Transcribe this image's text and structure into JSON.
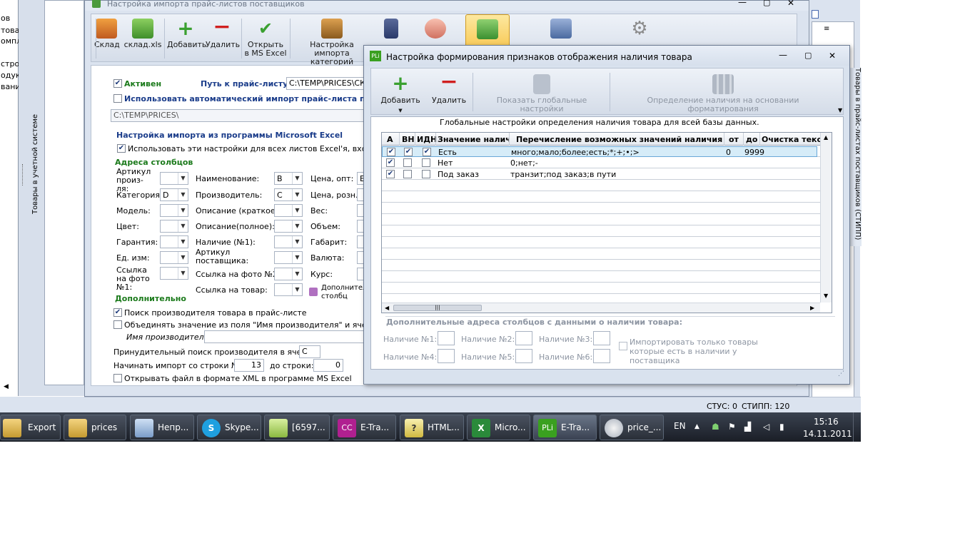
{
  "left_clip": {
    "lines": [
      "ов",
      "това",
      "омпл",
      "",
      "стро",
      "одук",
      "вани"
    ]
  },
  "main_window": {
    "title": "Настройка импорта прайс-листов поставщиков",
    "vertical_tab_left": "Товары в учетной системе",
    "toolbar": [
      {
        "label": "Склад",
        "icon": "truck-icon"
      },
      {
        "label": "склад.xls",
        "icon": "xls-icon"
      },
      {
        "label": "Добавить",
        "icon": "plus-icon"
      },
      {
        "label": "Удалить",
        "icon": "minus-icon"
      },
      {
        "label": "Открыть в MS Excel",
        "icon": "checkmark-icon"
      },
      {
        "label": "Настройка импорта категорий",
        "icon": "import-icon"
      }
    ],
    "active_label": "Активен",
    "path_label": "Путь к прайс-листу:",
    "path_value": "C:\\TEMP\\PRICES\\СКЛ",
    "auto_import_label": "Использовать автоматический импорт прайс-листа поста",
    "auto_path_value": "C:\\TEMP\\PRICES\\",
    "excel_group_title": "Настройка импорта из программы Microsoft Excel",
    "use_all_sheets_label": "Использовать эти настройки для всех листов Excel'я, входящих",
    "columns_group_title": "Адреса столбцов",
    "col1": [
      {
        "label": "Артикул произ-ля:",
        "value": ""
      },
      {
        "label": "Категория:",
        "value": "D"
      },
      {
        "label": "Модель:",
        "value": ""
      },
      {
        "label": "Цвет:",
        "value": ""
      },
      {
        "label": "Гарантия:",
        "value": ""
      },
      {
        "label": "Ед. изм:",
        "value": ""
      },
      {
        "label": "Ссылка на фото №1:",
        "value": ""
      }
    ],
    "col2": [
      {
        "label": "Наименование:",
        "value": "B"
      },
      {
        "label": "Производитель:",
        "value": "C"
      },
      {
        "label": "Описание (краткое):",
        "value": ""
      },
      {
        "label": "Описание(полное):",
        "value": ""
      },
      {
        "label": "Наличие (№1):",
        "value": ""
      },
      {
        "label": "Артикул поставщика:",
        "value": ""
      },
      {
        "label": "Ссылка на фото №2:",
        "value": ""
      },
      {
        "label": "Ссылка на товар:",
        "value": ""
      }
    ],
    "col3": [
      {
        "label": "Цена, опт:",
        "value": "E"
      },
      {
        "label": "Цена, розн.:",
        "value": ""
      },
      {
        "label": "Вес:",
        "value": ""
      },
      {
        "label": "Объем:",
        "value": ""
      },
      {
        "label": "Габарит:",
        "value": ""
      },
      {
        "label": "Валюта:",
        "value": ""
      },
      {
        "label": "Курс:",
        "value": ""
      },
      {
        "label": "Дополнител столбц",
        "value": ""
      }
    ],
    "extra_group_title": "Дополнительно",
    "search_manufacturer_label": "Поиск производителя товара в прайс-листе",
    "merge_label": "Объединять значение из поля \"Имя производителя\" и ячейки \"На",
    "manufacturer_name_label": "Имя производителя:",
    "forced_search_label": "Принудительный поиск производителя в ячейке:",
    "forced_search_value": "C",
    "start_row_label": "Начинать импорт со строки №:",
    "start_row_value": "13",
    "to_row_label": "до строки:",
    "to_row_value": "0",
    "xml_label": "Открывать файл в формате XML в программе MS Excel"
  },
  "right_vertical_tab": "Товары в прайс-листах поставщиков (СТИПП)",
  "dialog": {
    "app_icon_text": "PLi",
    "title": "Настройка формирования признаков отображения наличия товара",
    "toolbar": {
      "add": "Добавить",
      "remove": "Удалить",
      "show_global": "Показать глобальные настройки",
      "by_format": "Определение наличия на основании форматирования"
    },
    "grid_caption": "Глобальные настройки определения наличия товара для всей базы данных.",
    "columns": [
      "А",
      "ВН",
      "ИДН",
      "Значение налич",
      "Перечисление возможных значений наличия",
      "от",
      "до",
      "Очистка текс"
    ],
    "rows": [
      {
        "a": true,
        "vn": true,
        "idn": true,
        "value": "Есть",
        "values": "много;мало;более;есть;*;+;•;>",
        "from": "0",
        "to": "9999"
      },
      {
        "a": true,
        "vn": false,
        "idn": false,
        "value": "Нет",
        "values": "0;нет;-",
        "from": "",
        "to": ""
      },
      {
        "a": true,
        "vn": false,
        "idn": false,
        "value": "Под заказ",
        "values": "транзит;под заказ;в пути",
        "from": "",
        "to": ""
      }
    ],
    "extra_title": "Дополнительные адреса столбцов с данными о наличии товара:",
    "extra_fields": [
      "Наличие №1:",
      "Наличие №2:",
      "Наличие №3:",
      "Наличие №4:",
      "Наличие №5:",
      "Наличие №6:"
    ],
    "import_only_label": "Импортировать только товары которые есть в наличии у поставщика"
  },
  "statusbar": {
    "stus": "СТУС: 0",
    "stipp": "СТИПП: 120"
  },
  "taskbar": {
    "items": [
      "Export",
      "prices",
      "Непр...",
      "Skype...",
      "[6597...",
      "E-Tra...",
      "HTML...",
      "Micro...",
      "E-Tra...",
      "price_..."
    ],
    "lang": "EN",
    "time": "15:16",
    "date": "14.11.2011"
  }
}
